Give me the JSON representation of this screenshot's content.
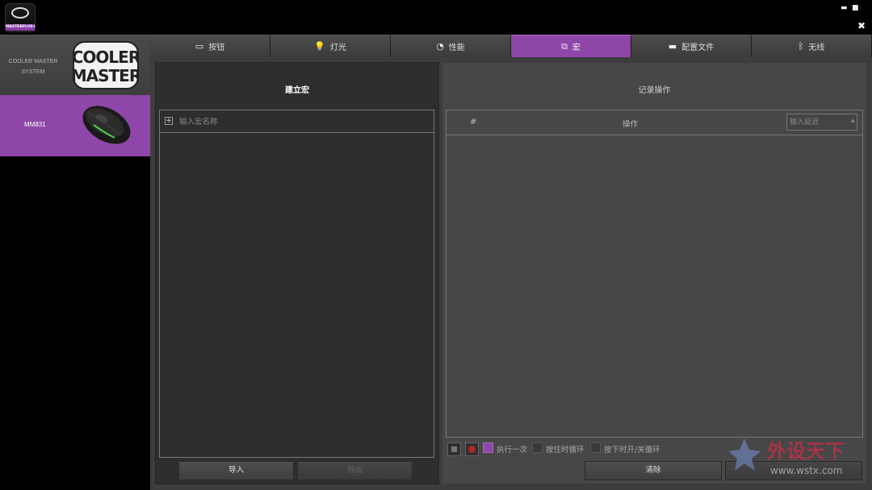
{
  "app": {
    "brand_label": "MASTERPLUS+"
  },
  "window_controls": {
    "minimize": "▬",
    "maximize": "■",
    "close": "✖"
  },
  "sidebar": {
    "system_label": "COOLER MASTER SYSTEM",
    "device_name": "MM831"
  },
  "tabs": [
    {
      "label": "按钮",
      "icon": "button-icon",
      "glyph": "▭"
    },
    {
      "label": "灯光",
      "icon": "light-bulb-icon",
      "glyph": "💡"
    },
    {
      "label": "性能",
      "icon": "performance-gauge-icon",
      "glyph": "◔"
    },
    {
      "label": "宏",
      "icon": "macro-icon",
      "glyph": "⧉"
    },
    {
      "label": "配置文件",
      "icon": "profile-icon",
      "glyph": "▬"
    },
    {
      "label": "无线",
      "icon": "bluetooth-icon",
      "glyph": "ᛒ"
    }
  ],
  "active_tab": 3,
  "macro_panel": {
    "title": "建立宏",
    "name_placeholder": "输入宏名称",
    "import_label": "导入",
    "export_label": "导出"
  },
  "record_panel": {
    "title": "记录操作",
    "col_num": "#",
    "col_action": "操作",
    "delay_placeholder": "输入延迟",
    "modes": [
      "执行一次",
      "按住时循环",
      "按下时开/关循环"
    ],
    "selected_mode": 0,
    "clear_label": "清除"
  },
  "watermark": {
    "text": "外设天下",
    "url": "www.wstx.com"
  },
  "colors": {
    "accent": "#8e47a8",
    "record": "#b02a2a"
  }
}
